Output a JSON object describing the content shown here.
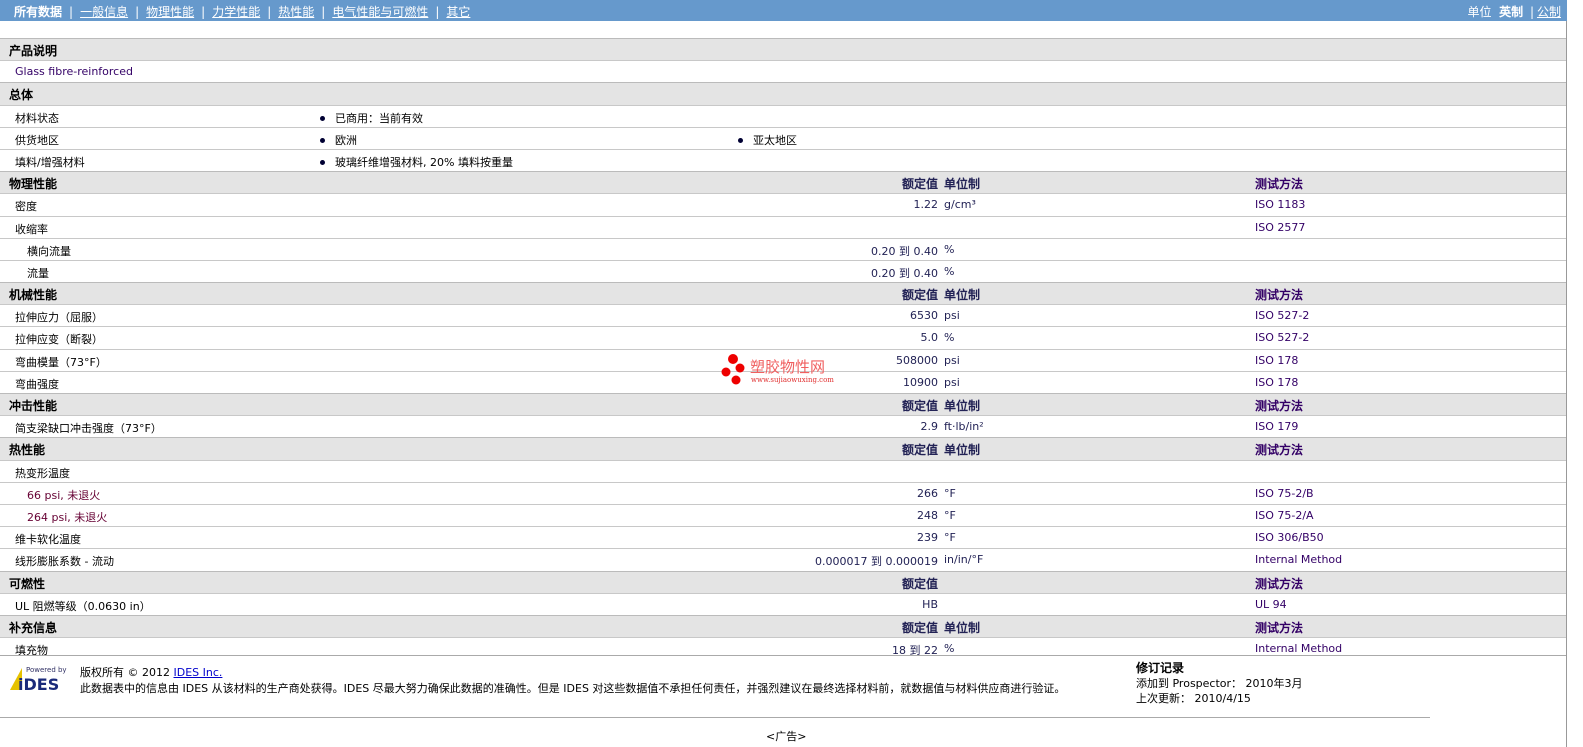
{
  "nav": {
    "items": [
      "所有数据",
      "一般信息",
      "物理性能",
      "力学性能",
      "热性能",
      "电气性能与可燃性",
      "其它"
    ],
    "units_label": "单位",
    "unit_english": "英制",
    "unit_metric": "公制"
  },
  "headers": {
    "value": "额定值",
    "unit": "单位制",
    "method": "测试方法"
  },
  "rows": [
    {
      "type": "h",
      "label": "产品说明"
    },
    {
      "type": "desc",
      "label": "Glass fibre-reinforced"
    },
    {
      "type": "h",
      "label": "总体"
    },
    {
      "type": "bul",
      "label": "材料状态",
      "b1": "已商用：当前有效"
    },
    {
      "type": "bul",
      "label": "供货地区",
      "b1": "欧洲",
      "b2": "亚太地区"
    },
    {
      "type": "bul",
      "label": "填料/增强材料",
      "b1": "玻璃纤维增强材料, 20% 填料按重量"
    },
    {
      "type": "h",
      "label": "物理性能",
      "cols": 3
    },
    {
      "type": "d",
      "label": "密度",
      "value": "1.22",
      "unit": "g/cm³",
      "method": "ISO 1183"
    },
    {
      "type": "d",
      "label": "收缩率",
      "method": "ISO 2577"
    },
    {
      "type": "d",
      "sub": true,
      "label": "横向流量",
      "value": "0.20 到  0.40",
      "unit": "%"
    },
    {
      "type": "d",
      "sub": true,
      "label": "流量",
      "value": "0.20 到  0.40",
      "unit": "%"
    },
    {
      "type": "h",
      "label": "机械性能",
      "cols": 3
    },
    {
      "type": "d",
      "label": "拉伸应力（屈服）",
      "value": "6530",
      "unit": "psi",
      "method": "ISO 527-2"
    },
    {
      "type": "d",
      "label": "拉伸应变（断裂）",
      "value": "5.0",
      "unit": "%",
      "method": "ISO 527-2"
    },
    {
      "type": "d",
      "label": "弯曲模量（73°F）",
      "value": "508000",
      "unit": "psi",
      "method": "ISO 178"
    },
    {
      "type": "d",
      "label": "弯曲强度",
      "value": "10900",
      "unit": "psi",
      "method": "ISO 178"
    },
    {
      "type": "h",
      "label": "冲击性能",
      "cols": 3
    },
    {
      "type": "d",
      "label": "简支梁缺口冲击强度（73°F）",
      "value": "2.9",
      "unit": "ft·lb/in²",
      "method": "ISO 179"
    },
    {
      "type": "h",
      "label": "热性能",
      "cols": 3
    },
    {
      "type": "d",
      "label": "热变形温度"
    },
    {
      "type": "d",
      "sub": true,
      "red": true,
      "label": "66 psi, 未退火",
      "value": "266",
      "unit": "°F",
      "method": "ISO 75-2/B"
    },
    {
      "type": "d",
      "sub": true,
      "red": true,
      "label": "264 psi, 未退火",
      "value": "248",
      "unit": "°F",
      "method": "ISO 75-2/A"
    },
    {
      "type": "d",
      "label": "维卡软化温度",
      "value": "239",
      "unit": "°F",
      "method": "ISO 306/B50"
    },
    {
      "type": "d",
      "label": "线形膨胀系数 - 流动",
      "value": "0.000017 到  0.000019",
      "unit": "in/in/°F",
      "method": "Internal Method"
    },
    {
      "type": "h",
      "label": "可燃性",
      "cols": 2
    },
    {
      "type": "d",
      "label": "UL 阻燃等级（0.0630 in）",
      "value": "HB",
      "method": "UL 94"
    },
    {
      "type": "h",
      "label": "补充信息",
      "cols": 3
    },
    {
      "type": "d",
      "label": "填充物",
      "value": "18 到  22",
      "unit": "%",
      "method": "Internal Method"
    }
  ],
  "footer": {
    "logo_text": "Powered by IDES",
    "copyright": "版权所有 © 2012",
    "company_link": "IDES Inc.",
    "disclaimer": "此数据表中的信息由 IDES 从该材料的生产商处获得。IDES 尽最大努力确保此数据的准确性。但是 IDES 对这些数据值不承担任何责任，并强烈建议在最终选择材料前，就数据值与材料供应商进行验证。",
    "revision_title": "修订记录",
    "added_label": "添加到 Prospector：",
    "added_value": "2010年3月",
    "updated_label": "上次更新：",
    "updated_value": "2010/4/15"
  },
  "watermark": {
    "name": "塑胶物性网",
    "url": "www.sujiaowuxing.com"
  },
  "ad": "<广告>"
}
